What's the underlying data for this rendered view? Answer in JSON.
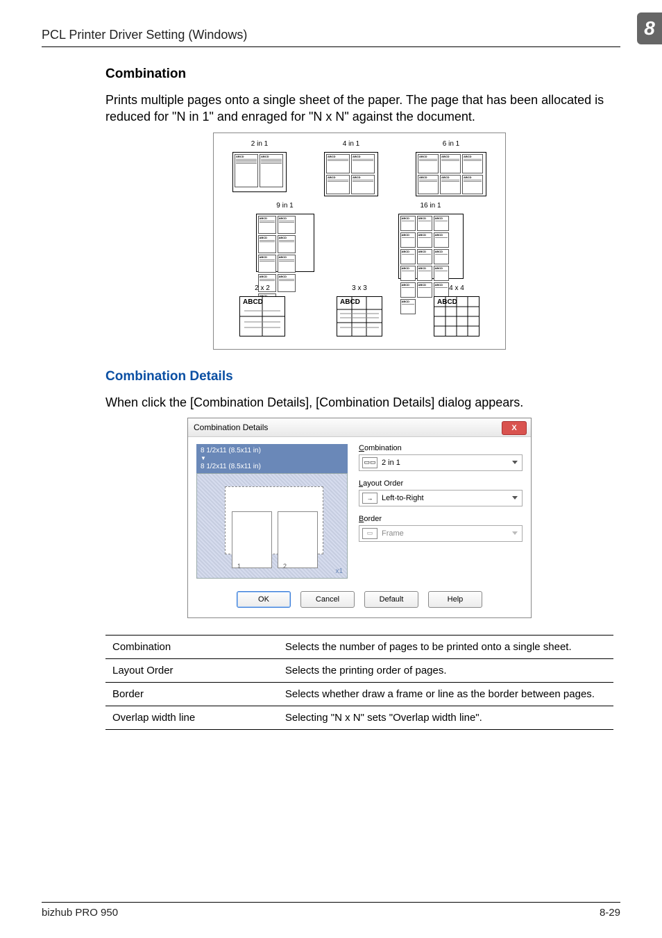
{
  "header": {
    "title": "PCL Printer Driver Setting (Windows)",
    "chapter": "8"
  },
  "section1": {
    "heading": "Combination",
    "body": "Prints multiple pages onto a single sheet of the paper. The page that has been allocated is reduced for \"N in 1\" and enraged for \"N x N\" against the document."
  },
  "illus": {
    "row1": [
      "2 in 1",
      "4 in 1",
      "6 in 1"
    ],
    "row2": [
      "9 in 1",
      "16 in 1"
    ],
    "row3": [
      "2 x 2",
      "3 x 3",
      "4 x 4"
    ],
    "thumb_title": "ABCD"
  },
  "section2": {
    "heading": "Combination Details",
    "body": "When click the [Combination Details], [Combination Details] dialog appears."
  },
  "dialog": {
    "title": "Combination Details",
    "close": "X",
    "paper_from": "8 1/2x11 (8.5x11 in)",
    "paper_to": "8 1/2x11 (8.5x11 in)",
    "zoom": "x1",
    "fields": {
      "combination_lbl": "Combination",
      "combination_val": "2 in 1",
      "layout_lbl": "Layout Order",
      "layout_val": "Left-to-Right",
      "border_lbl": "Border",
      "border_val": "Frame"
    },
    "buttons": {
      "ok": "OK",
      "cancel": "Cancel",
      "def": "Default",
      "help": "Help"
    }
  },
  "table": {
    "rows": [
      {
        "k": "Combination",
        "v": "Selects the number of pages to be printed onto a single sheet."
      },
      {
        "k": "Layout Order",
        "v": "Selects the printing order of pages."
      },
      {
        "k": "Border",
        "v": "Selects whether draw a frame or line as the border between pages."
      },
      {
        "k": "Overlap width line",
        "v": "Selecting \"N x N\" sets \"Overlap width line\"."
      }
    ]
  },
  "footer": {
    "left": "bizhub PRO 950",
    "right": "8-29"
  }
}
